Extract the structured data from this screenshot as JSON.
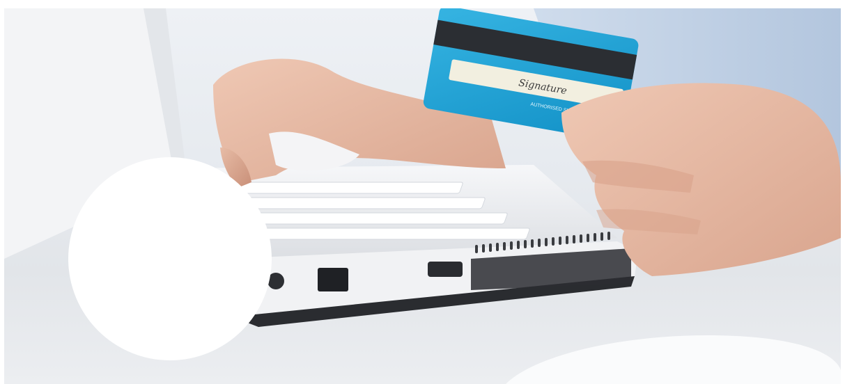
{
  "scene": {
    "subject": "online-payment-photo",
    "card": {
      "signature_text": "Signature",
      "strip_label": "AUTHORISED SIGNATURE",
      "colors": {
        "card": "#1fa6d8",
        "stripe": "#2b2e33",
        "panel": "#f2efe0"
      }
    },
    "badge": {
      "color": "#ffffff"
    }
  }
}
